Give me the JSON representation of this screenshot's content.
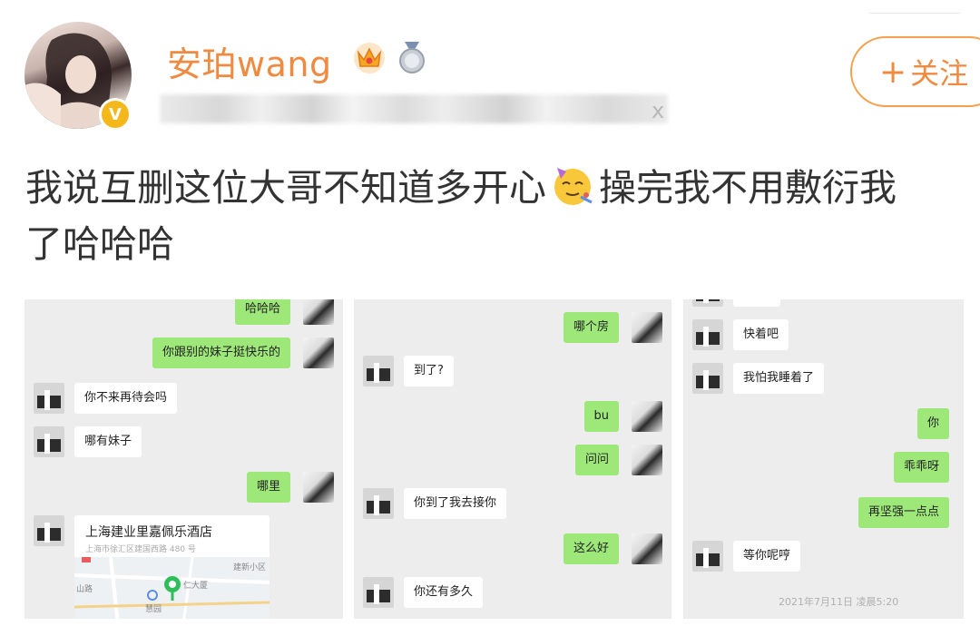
{
  "profile": {
    "username": "安珀wang",
    "verified_badge": "V",
    "meta_hidden_suffix": "x",
    "follow_label": "关注",
    "follow_icon": "plus-icon"
  },
  "post": {
    "text_part1": "我说互删这位大哥不知道多开心",
    "emoji": "partying-face",
    "text_part2": "操完我不用敷衍我",
    "text_line2": "了哈哈哈"
  },
  "chat_panels": [
    {
      "messages": [
        {
          "side": "right",
          "text": "哈哈哈"
        },
        {
          "side": "right",
          "text": "你跟别的妹子挺快乐的"
        },
        {
          "side": "left",
          "text": "你不来再待会吗"
        },
        {
          "side": "left",
          "text": "哪有妹子"
        },
        {
          "side": "right",
          "text": "哪里"
        }
      ],
      "location": {
        "title": "上海建业里嘉佩乐酒店",
        "address": "上海市徐汇区建国西路 480 号",
        "map_labels": [
          "建新小区",
          "仁大厦",
          "慧园",
          "山路"
        ]
      }
    },
    {
      "messages": [
        {
          "side": "right",
          "text": "哪个房"
        },
        {
          "side": "left",
          "text": "到了?"
        },
        {
          "side": "right",
          "text": "bu"
        },
        {
          "side": "right",
          "text": "问问"
        },
        {
          "side": "left",
          "text": "你到了我去接你"
        },
        {
          "side": "right",
          "text": "这么好"
        },
        {
          "side": "left",
          "text": "你还有多久"
        }
      ]
    },
    {
      "messages": [
        {
          "side": "left",
          "text": "快着吧"
        },
        {
          "side": "left",
          "text": "我怕我睡着了"
        },
        {
          "side": "right",
          "text": "你"
        },
        {
          "side": "right",
          "text": "乖乖呀"
        },
        {
          "side": "right",
          "text": "再坚强一点点"
        },
        {
          "side": "left",
          "text": "等你呢哼"
        }
      ],
      "timestamp": "2021年7月11日 凌晨5:20"
    }
  ],
  "colors": {
    "username": "#f08a41",
    "follow_border": "#f5a04e",
    "verified": "#f5b81b",
    "bubble_right": "#9ee87a",
    "bubble_left": "#ffffff",
    "chat_bg": "#ededed"
  }
}
